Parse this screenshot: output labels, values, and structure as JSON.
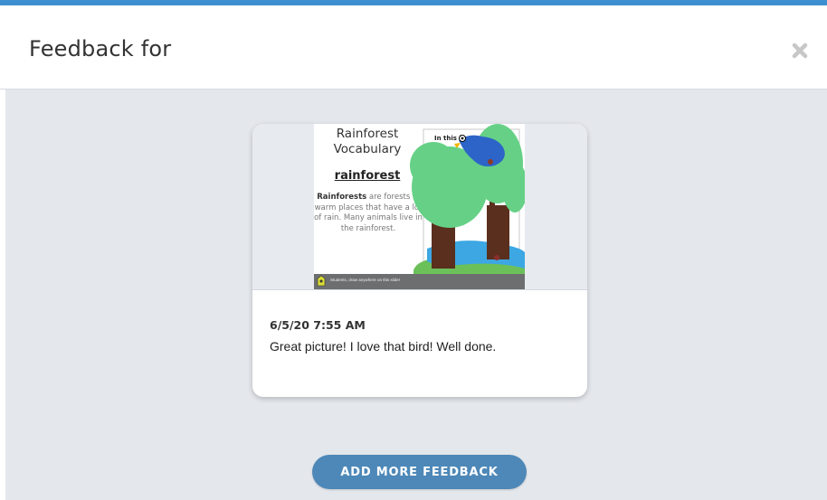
{
  "header": {
    "title": "Feedback for",
    "close_icon": "close-x-icon"
  },
  "slide": {
    "title_line1": "Rainforest",
    "title_line2": "Vocabulary",
    "word": "rainforest",
    "definition_bold": "Rainforests",
    "definition_rest": " are forests in warm places that have a lot of rain. Many animals live in the rainforest.",
    "drawing_label": "In this ho",
    "footer_text": "Students, draw anywhere on this slide!",
    "footer_icon": "logo-icon"
  },
  "feedback": {
    "timestamp": "6/5/20 7:55 AM",
    "message": "Great picture! I love that bird! Well done."
  },
  "actions": {
    "add_more_label": "ADD MORE FEEDBACK"
  },
  "colors": {
    "accent": "#3d8fd0",
    "button": "#4d88b8",
    "background": "#e4e7ec"
  }
}
